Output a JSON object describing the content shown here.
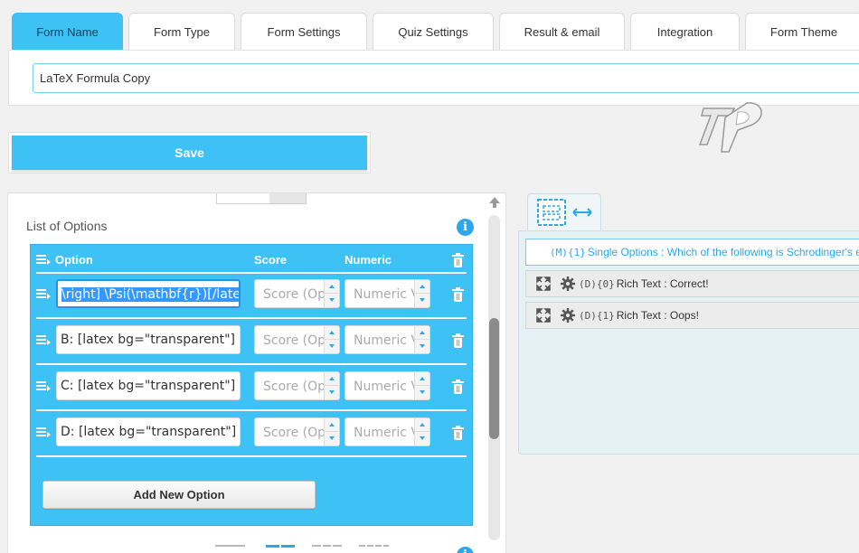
{
  "tabs": [
    {
      "label": "Form Name",
      "active": true
    },
    {
      "label": "Form Type",
      "active": false
    },
    {
      "label": "Form Settings",
      "active": false
    },
    {
      "label": "Quiz Settings",
      "active": false
    },
    {
      "label": "Result & email",
      "active": false
    },
    {
      "label": "Integration",
      "active": false
    },
    {
      "label": "Form Theme",
      "active": false
    }
  ],
  "form_name": {
    "value": "LaTeX Formula Copy"
  },
  "save": {
    "label": "Save"
  },
  "options_panel": {
    "title": "List of Options",
    "columns": {
      "option": "Option",
      "score": "Score",
      "numeric": "Numeric"
    },
    "rows": [
      {
        "option_pre": "\\right] \\Psi(\\mathbf{r})[/latex",
        "option_underlined": "mathbf",
        "score_placeholder": "Score (Optional)",
        "numeric_placeholder": "Numeric Value"
      },
      {
        "option": "B: [latex bg=\"transparent\"] E \\",
        "score_placeholder": "Score (Optional)",
        "numeric_placeholder": "Numeric Value"
      },
      {
        "option": "C: [latex bg=\"transparent\"] E \\",
        "score_placeholder": "Score (Optional)",
        "numeric_placeholder": "Numeric Value"
      },
      {
        "option": "D: [latex bg=\"transparent\"] E \\",
        "score_placeholder": "Score (Optional)",
        "numeric_placeholder": "Numeric Value"
      }
    ],
    "add_label": "Add New Option",
    "info_glyph": "i"
  },
  "question_list": [
    {
      "code": "(M){1}",
      "text": "Single Options : Which of the following is Schrodinger's equation?"
    },
    {
      "code": "(D){0}",
      "text": "Rich Text : Correct!"
    },
    {
      "code": "(D){1}",
      "text": "Rich Text : Oops!"
    }
  ],
  "colors": {
    "accent": "#3ec2f5",
    "info": "#2ea6ea",
    "selection": "#3399ff"
  }
}
